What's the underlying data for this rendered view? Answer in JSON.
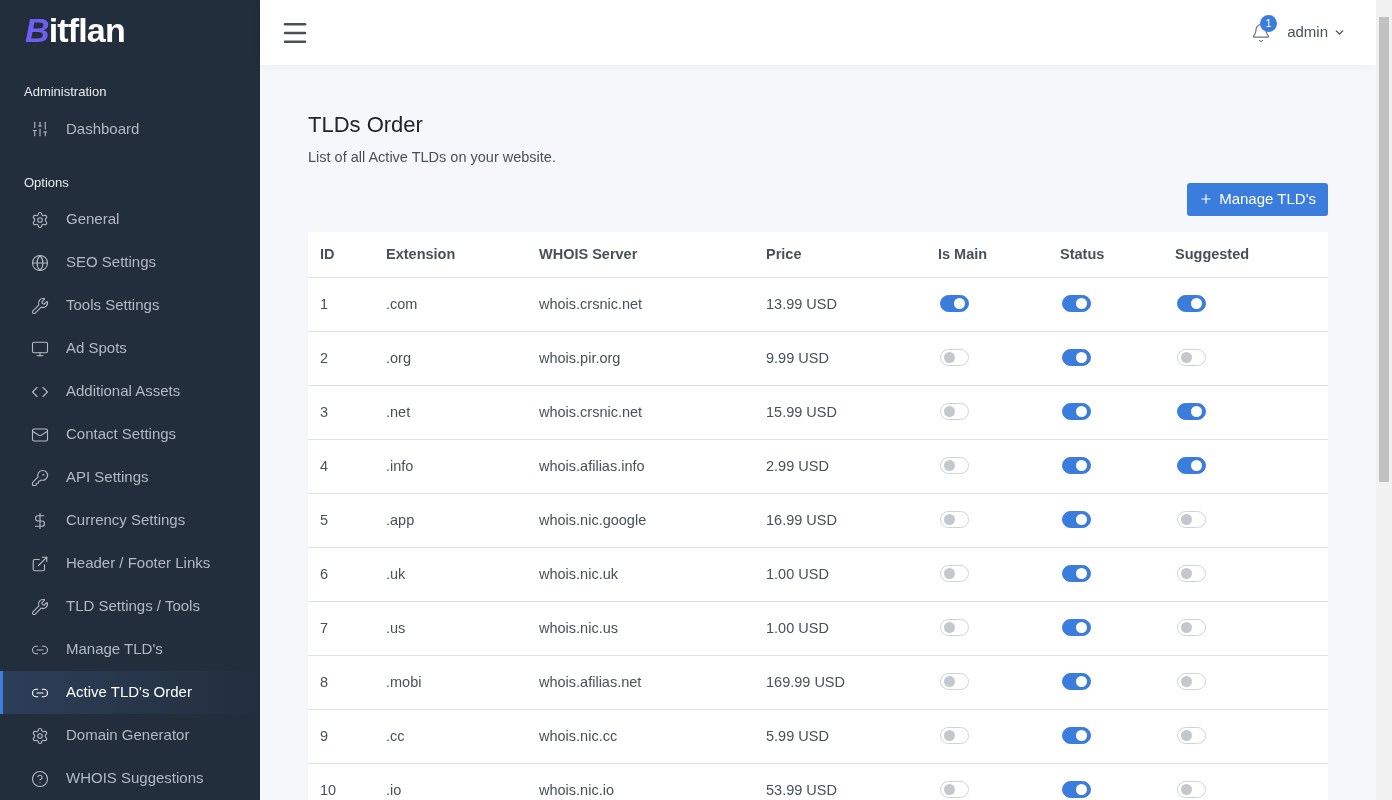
{
  "logo": "Bitflan",
  "sidebar": {
    "sections": [
      {
        "title": "Administration",
        "items": [
          {
            "label": "Dashboard",
            "selected": false
          }
        ]
      },
      {
        "title": "Options",
        "items": [
          {
            "label": "General",
            "selected": false
          },
          {
            "label": "SEO Settings",
            "selected": false
          },
          {
            "label": "Tools Settings",
            "selected": false
          },
          {
            "label": "Ad Spots",
            "selected": false
          },
          {
            "label": "Additional Assets",
            "selected": false
          },
          {
            "label": "Contact Settings",
            "selected": false
          },
          {
            "label": "API Settings",
            "selected": false
          },
          {
            "label": "Currency Settings",
            "selected": false
          },
          {
            "label": "Header / Footer Links",
            "selected": false
          },
          {
            "label": "TLD Settings / Tools",
            "selected": false
          },
          {
            "label": "Manage TLD's",
            "selected": false
          },
          {
            "label": "Active TLD's Order",
            "selected": true
          },
          {
            "label": "Domain Generator",
            "selected": false
          },
          {
            "label": "WHOIS Suggestions",
            "selected": false
          }
        ]
      }
    ]
  },
  "header": {
    "notification_count": "1",
    "user": "admin"
  },
  "page": {
    "title": "TLDs Order",
    "subtitle": "List of all Active TLDs on your website.",
    "button": "Manage TLD's"
  },
  "table": {
    "columns": [
      "ID",
      "Extension",
      "WHOIS Server",
      "Price",
      "Is Main",
      "Status",
      "Suggested"
    ],
    "rows": [
      {
        "id": "1",
        "extension": ".com",
        "whois": "whois.crsnic.net",
        "price": "13.99 USD",
        "is_main": true,
        "status": true,
        "suggested": true
      },
      {
        "id": "2",
        "extension": ".org",
        "whois": "whois.pir.org",
        "price": "9.99 USD",
        "is_main": false,
        "status": true,
        "suggested": false
      },
      {
        "id": "3",
        "extension": ".net",
        "whois": "whois.crsnic.net",
        "price": "15.99 USD",
        "is_main": false,
        "status": true,
        "suggested": true
      },
      {
        "id": "4",
        "extension": ".info",
        "whois": "whois.afilias.info",
        "price": "2.99 USD",
        "is_main": false,
        "status": true,
        "suggested": true
      },
      {
        "id": "5",
        "extension": ".app",
        "whois": "whois.nic.google",
        "price": "16.99 USD",
        "is_main": false,
        "status": true,
        "suggested": false
      },
      {
        "id": "6",
        "extension": ".uk",
        "whois": "whois.nic.uk",
        "price": "1.00 USD",
        "is_main": false,
        "status": true,
        "suggested": false
      },
      {
        "id": "7",
        "extension": ".us",
        "whois": "whois.nic.us",
        "price": "1.00 USD",
        "is_main": false,
        "status": true,
        "suggested": false
      },
      {
        "id": "8",
        "extension": ".mobi",
        "whois": "whois.afilias.net",
        "price": "169.99 USD",
        "is_main": false,
        "status": true,
        "suggested": false
      },
      {
        "id": "9",
        "extension": ".cc",
        "whois": "whois.nic.cc",
        "price": "5.99 USD",
        "is_main": false,
        "status": true,
        "suggested": false
      },
      {
        "id": "10",
        "extension": ".io",
        "whois": "whois.nic.io",
        "price": "53.99 USD",
        "is_main": false,
        "status": true,
        "suggested": false
      }
    ]
  }
}
